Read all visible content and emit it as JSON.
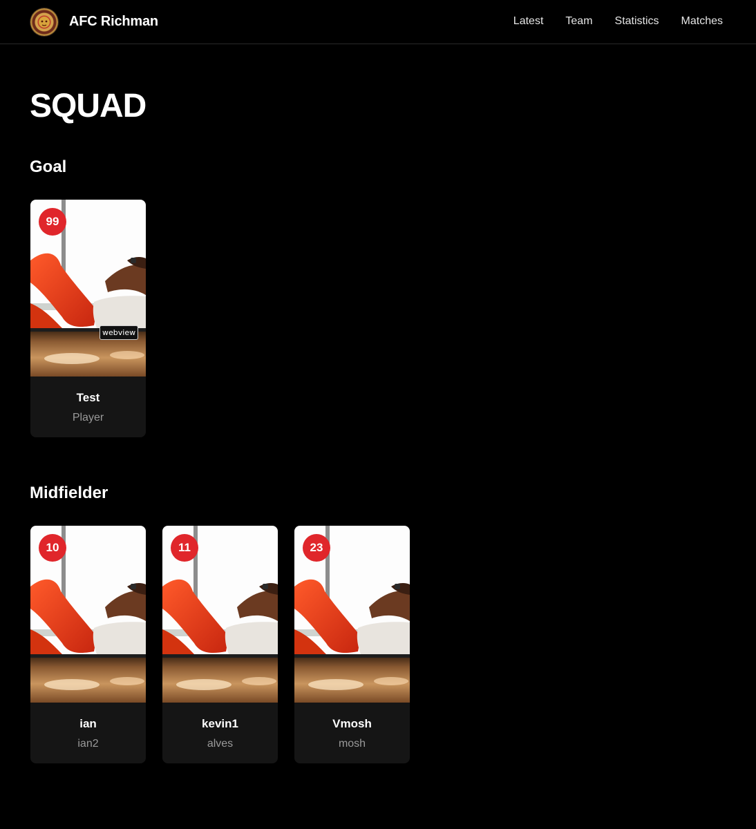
{
  "header": {
    "brand": "AFC Richman",
    "nav": [
      "Latest",
      "Team",
      "Statistics",
      "Matches"
    ]
  },
  "page": {
    "title": "SQUAD"
  },
  "sections": [
    {
      "title": "Goal",
      "players": [
        {
          "number": "99",
          "name": "Test",
          "sub": "Player"
        }
      ]
    },
    {
      "title": "Midfielder",
      "players": [
        {
          "number": "10",
          "name": "ian",
          "sub": "ian2"
        },
        {
          "number": "11",
          "name": "kevin1",
          "sub": "alves"
        },
        {
          "number": "23",
          "name": "Vmosh",
          "sub": "mosh"
        }
      ]
    }
  ],
  "tooltip": "webview",
  "colors": {
    "background": "#000000",
    "badge": "#e0262b",
    "card": "#151515"
  }
}
